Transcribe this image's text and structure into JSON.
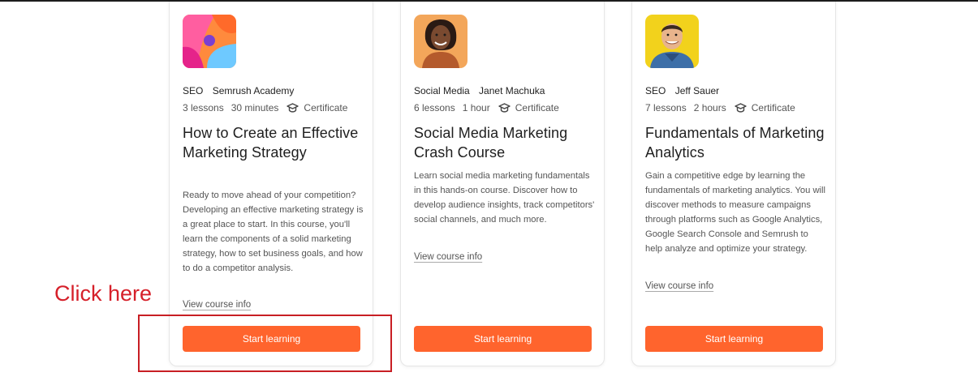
{
  "courses": [
    {
      "category": "SEO",
      "author": "Semrush Academy",
      "lessons": "3 lessons",
      "duration": "30 minutes",
      "certificate": "Certificate",
      "title": "How to Create an Effective Marketing Strategy",
      "description": "Ready to move ahead of your competition? Developing an effective marketing strategy is a great place to start. In this course, you'll learn the components of a solid marketing strategy, how to set business goals, and how to do a competitor analysis.",
      "link": "View course info",
      "button": "Start learning"
    },
    {
      "category": "Social Media",
      "author": "Janet Machuka",
      "lessons": "6 lessons",
      "duration": "1 hour",
      "certificate": "Certificate",
      "title": "Social Media Marketing Crash Course",
      "description": "Learn social media marketing fundamentals in this hands-on course. Discover how to develop audience insights, track competitors' social channels, and much more.",
      "link": "View course info",
      "button": "Start learning"
    },
    {
      "category": "SEO",
      "author": "Jeff Sauer",
      "lessons": "7 lessons",
      "duration": "2 hours",
      "certificate": "Certificate",
      "title": "Fundamentals of Marketing Analytics",
      "description": "Gain a competitive edge by learning the fundamentals of marketing analytics. You will discover methods to measure campaigns through platforms such as Google Analytics, Google Search Console and Semrush to help analyze and optimize your strategy.",
      "link": "View course info",
      "button": "Start learning"
    }
  ],
  "annotation": {
    "text": "Click here"
  },
  "colors": {
    "button": "#ff642d",
    "annotation": "#d6202a"
  },
  "icons": [
    "abstract-course-thumbnail",
    "instructor-photo",
    "certificate-icon"
  ]
}
